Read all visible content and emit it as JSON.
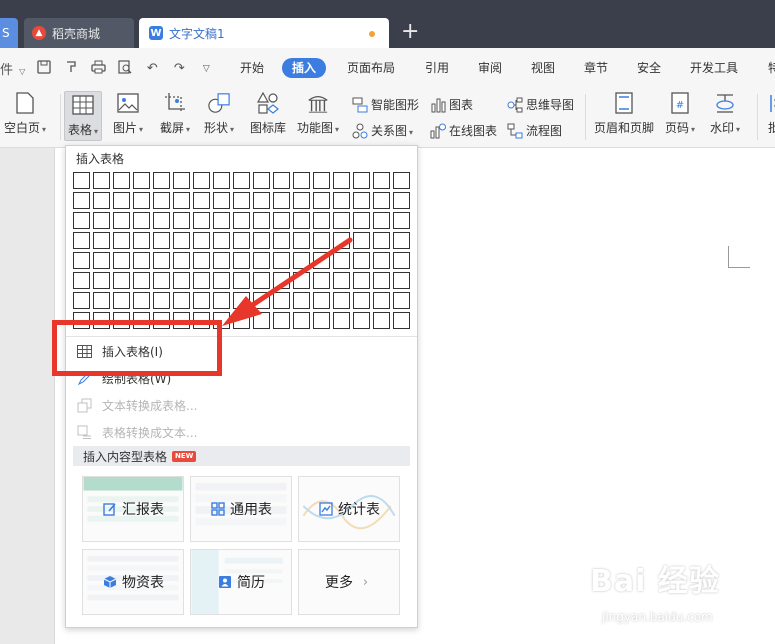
{
  "titlebar": {
    "tab_ws": "S",
    "tab_store": "稻壳商城",
    "tab_doc": "文字文稿1",
    "new_tab": "+"
  },
  "menubar": {
    "file_label": "件",
    "tabs": [
      "开始",
      "插入",
      "页面布局",
      "引用",
      "审阅",
      "视图",
      "章节",
      "安全",
      "开发工具",
      "特"
    ],
    "active_tab": "插入"
  },
  "ribbon": {
    "blank_page": "空白页",
    "table": "表格",
    "picture": "图片",
    "screenshot": "截屏",
    "shape": "形状",
    "icon_lib": "图标库",
    "function_chart": "功能图",
    "smart_shape": "智能图形",
    "chart": "图表",
    "mind_map": "思维导图",
    "relation_chart": "关系图",
    "online_chart": "在线图表",
    "flowchart": "流程图",
    "header_footer": "页眉和页脚",
    "page_number": "页码",
    "watermark": "水印",
    "batch": "批"
  },
  "dropdown": {
    "header": "插入表格",
    "grid_cols": 17,
    "grid_rows": 8,
    "items": [
      {
        "label": "插入表格(I)",
        "disabled": false
      },
      {
        "label": "绘制表格(W)",
        "disabled": false
      },
      {
        "label": "文本转换成表格...",
        "disabled": true
      },
      {
        "label": "表格转换成文本...",
        "disabled": true
      }
    ],
    "section_title": "插入内容型表格",
    "new_badge": "NEW",
    "cards": [
      {
        "label": "汇报表"
      },
      {
        "label": "通用表"
      },
      {
        "label": "统计表"
      },
      {
        "label": "物资表"
      },
      {
        "label": "简历"
      },
      {
        "label": "更多"
      }
    ]
  },
  "watermark": {
    "main": "Bai 经验",
    "sub": "jingyan.baidu.com"
  },
  "colors": {
    "accent": "#3b7de0",
    "annotation_red": "#e8372a",
    "titlebar": "#3a3f4b"
  }
}
